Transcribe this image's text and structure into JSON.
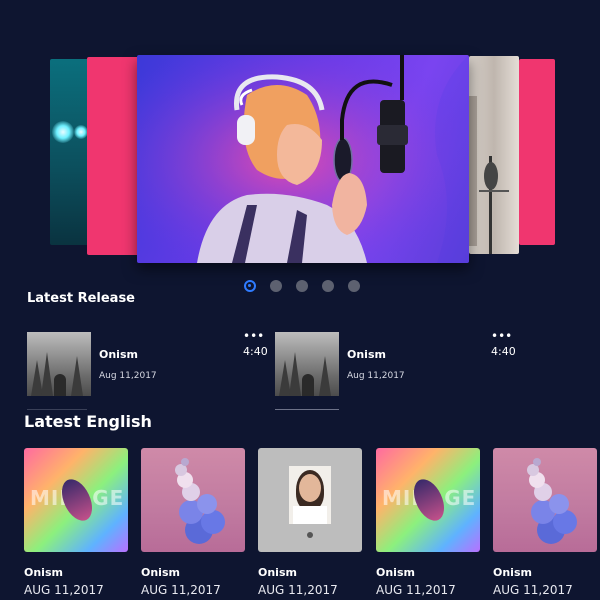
{
  "sections": {
    "latest_release": "Latest Release",
    "latest_english": "Latest English"
  },
  "carousel": {
    "slide_count": 5,
    "active_index": 0
  },
  "releases": [
    {
      "title": "Onism",
      "date": "Aug 11,2017",
      "duration": "4:40",
      "more": "•••"
    },
    {
      "title": "Onism",
      "date": "Aug 11,2017",
      "duration": "4:40",
      "more": "•••"
    }
  ],
  "albums": [
    {
      "title": "Onism",
      "date": "AUG 11,2017",
      "cover_text": "MIRAGE"
    },
    {
      "title": "Onism",
      "date": "AUG 11,2017"
    },
    {
      "title": "Onism",
      "date": "AUG 11,2017"
    },
    {
      "title": "Onism",
      "date": "AUG 11,2017",
      "cover_text": "MIRAGE"
    },
    {
      "title": "Onism",
      "date": "AUG 11,2017"
    }
  ]
}
